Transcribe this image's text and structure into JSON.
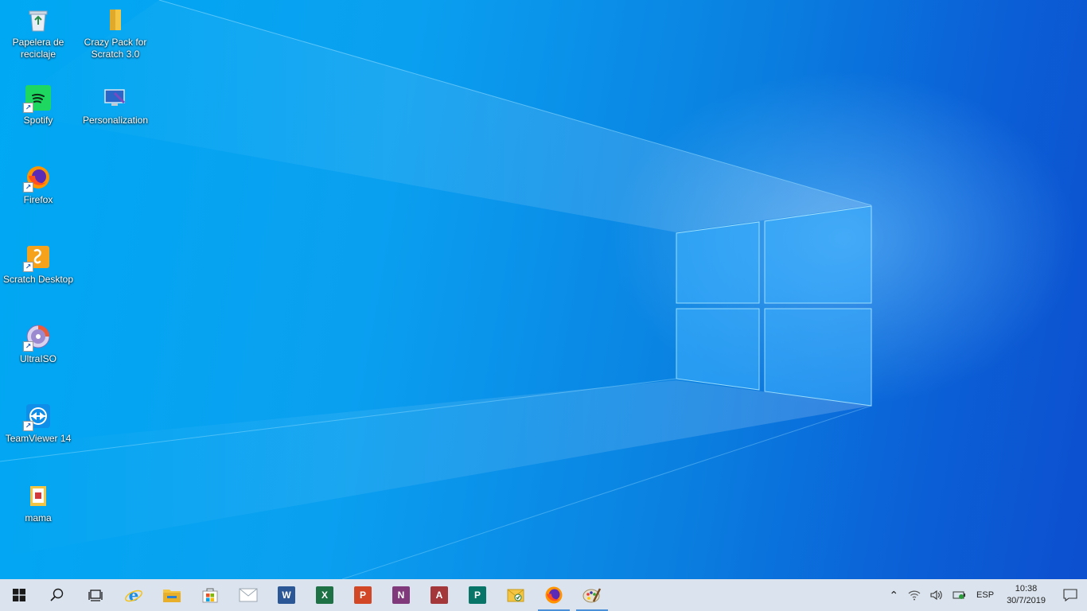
{
  "desktop": {
    "icons": [
      {
        "label": "Papelera de\nreciclaje",
        "icon": "recycle-bin-icon"
      },
      {
        "label": "Crazy Pack for\nScratch 3.0",
        "icon": "folder-icon"
      },
      {
        "label": "Spotify",
        "icon": "spotify-icon"
      },
      {
        "label": "Personalization",
        "icon": "personalization-icon"
      },
      {
        "label": "Firefox",
        "icon": "firefox-icon"
      },
      {
        "label": "Scratch Desktop",
        "icon": "scratch-icon"
      },
      {
        "label": "UltraISO",
        "icon": "ultraiso-icon"
      },
      {
        "label": "TeamViewer 14",
        "icon": "teamviewer-icon"
      },
      {
        "label": "mama",
        "icon": "folder-icon"
      }
    ]
  },
  "taskbar": {
    "pinned": [
      {
        "name": "start-button",
        "icon": "windows-logo-icon"
      },
      {
        "name": "search-button",
        "icon": "search-icon"
      },
      {
        "name": "task-view-button",
        "icon": "task-view-icon"
      },
      {
        "name": "internet-explorer",
        "icon": "internet-explorer-icon"
      },
      {
        "name": "file-explorer",
        "icon": "file-explorer-icon"
      },
      {
        "name": "microsoft-store",
        "icon": "store-icon"
      },
      {
        "name": "mail",
        "icon": "mail-icon"
      },
      {
        "name": "word",
        "icon": "word-icon",
        "letter": "W",
        "color": "#2b5797"
      },
      {
        "name": "excel",
        "icon": "excel-icon",
        "letter": "X",
        "color": "#1e7145"
      },
      {
        "name": "powerpoint",
        "icon": "powerpoint-icon",
        "letter": "P",
        "color": "#d24726"
      },
      {
        "name": "onenote",
        "icon": "onenote-icon",
        "letter": "N",
        "color": "#80397b"
      },
      {
        "name": "access",
        "icon": "access-icon",
        "letter": "A",
        "color": "#a4373a"
      },
      {
        "name": "publisher",
        "icon": "publisher-icon",
        "letter": "P",
        "color": "#077568"
      },
      {
        "name": "outlook",
        "icon": "outlook-icon"
      },
      {
        "name": "firefox",
        "icon": "firefox-icon",
        "active": true
      },
      {
        "name": "paint",
        "icon": "paint-icon",
        "active": true
      }
    ],
    "tray": {
      "language": "ESP",
      "time": "10:38",
      "date": "30/7/2019"
    }
  }
}
